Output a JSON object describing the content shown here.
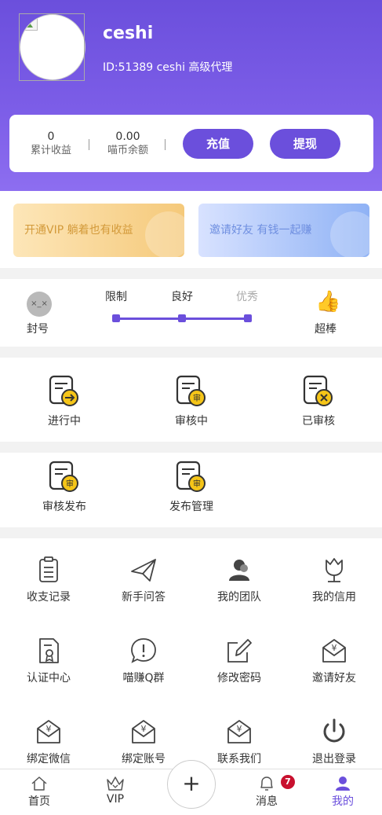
{
  "profile": {
    "username": "ceshi",
    "id_line": "ID:51389 ceshi 高级代理"
  },
  "wallet": {
    "earnings_value": "0",
    "earnings_label": "累计收益",
    "balance_value": "0.00",
    "balance_label": "喵币余额",
    "recharge_label": "充值",
    "withdraw_label": "提现"
  },
  "banners": {
    "vip": "开通VIP 躺着也有收益",
    "invite": "邀请好友 有钱一起赚"
  },
  "credit": {
    "banned_label": "封号",
    "banned_icon_text": "×_×",
    "levels": [
      "限制",
      "良好",
      "优秀"
    ],
    "great_label": "超棒"
  },
  "tasks": {
    "in_progress": "进行中",
    "reviewing": "审核中",
    "reviewed": "已审核"
  },
  "publish": {
    "review_publish": "审核发布",
    "publish_manage": "发布管理"
  },
  "menu": {
    "items": [
      "收支记录",
      "新手问答",
      "我的团队",
      "我的信用",
      "认证中心",
      "喵赚Q群",
      "修改密码",
      "邀请好友",
      "绑定微信",
      "绑定账号",
      "联系我们",
      "退出登录"
    ]
  },
  "tabbar": {
    "home": "首页",
    "vip": "VIP",
    "plus": "+",
    "messages": "消息",
    "messages_badge": "7",
    "me": "我的"
  },
  "colors": {
    "accent": "#6b4fdc",
    "badge": "#c8102e",
    "review_yellow": "#f5c518"
  }
}
